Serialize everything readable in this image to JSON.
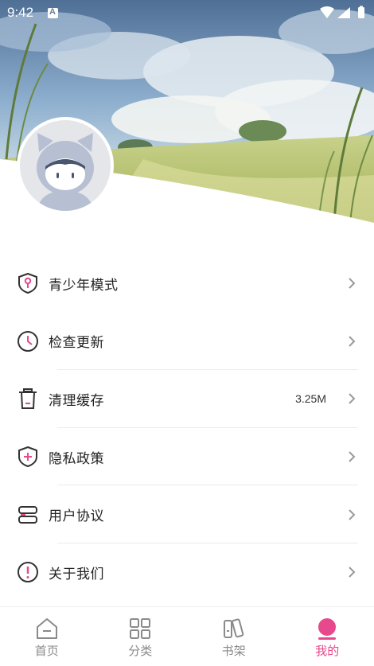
{
  "status_bar": {
    "time": "9:42"
  },
  "menu": [
    {
      "label": "青少年模式",
      "value": "",
      "icon": "shield-pin-icon"
    },
    {
      "label": "检查更新",
      "value": "",
      "icon": "clock-icon"
    },
    {
      "label": "清理缓存",
      "value": "3.25M",
      "icon": "trash-icon"
    },
    {
      "label": "隐私政策",
      "value": "",
      "icon": "shield-plus-icon"
    },
    {
      "label": "用户协议",
      "value": "",
      "icon": "agreement-icon"
    },
    {
      "label": "关于我们",
      "value": "",
      "icon": "info-exclamation-icon"
    }
  ],
  "bottom_nav": [
    {
      "label": "首页",
      "icon": "home-icon",
      "active": false
    },
    {
      "label": "分类",
      "icon": "grid-icon",
      "active": false
    },
    {
      "label": "书架",
      "icon": "books-icon",
      "active": false
    },
    {
      "label": "我的",
      "icon": "profile-icon",
      "active": true
    }
  ],
  "colors": {
    "accent": "#e8488c",
    "icon_stroke": "#333333",
    "inactive_nav": "#8a8a8a"
  }
}
